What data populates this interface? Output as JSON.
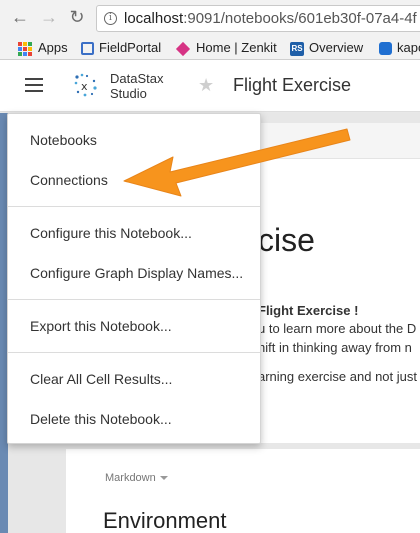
{
  "browser": {
    "url_host": "localhost",
    "url_rest": ":9091/notebooks/601eb30f-07a4-4f"
  },
  "bookmarks": [
    {
      "label": "Apps"
    },
    {
      "label": "FieldPortal"
    },
    {
      "label": "Home | Zenkit"
    },
    {
      "label": "Overview"
    },
    {
      "label": "kapo"
    }
  ],
  "header": {
    "brand_line1": "DataStax",
    "brand_line2": "Studio",
    "notebook_title": "Flight Exercise"
  },
  "menu": {
    "items": [
      {
        "label": "Notebooks"
      },
      {
        "label": "Connections"
      },
      {
        "label": "Configure this Notebook..."
      },
      {
        "label": "Configure Graph Display Names..."
      },
      {
        "label": "Export this Notebook..."
      },
      {
        "label": "Clear All Cell Results..."
      },
      {
        "label": "Delete this Notebook..."
      }
    ]
  },
  "background": {
    "heading_partial": "cise",
    "line1": "Flight Exercise !",
    "line2": "u to learn more about the D",
    "line3": "hift in thinking away from n",
    "line4": "arning exercise and not just",
    "cell_type": "Markdown",
    "env_heading": "Environment"
  },
  "colors": {
    "arrow": "#f7941d",
    "fieldportal": "#3b6fc6",
    "zenkit": "#d63384",
    "overview": "#1f5fa8"
  }
}
